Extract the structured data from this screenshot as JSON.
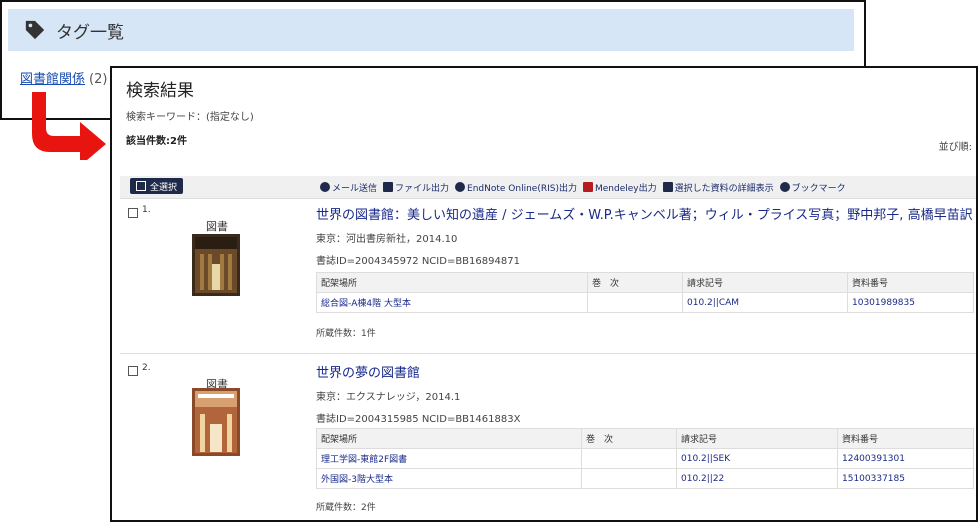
{
  "tag_panel": {
    "title": "タグ一覧",
    "tag_label": "図書館関係",
    "tag_count": "(2)"
  },
  "results": {
    "title": "検索結果",
    "keyword": "検索キーワード：(指定なし)",
    "count": "該当件数:2件",
    "sort": "並び順:",
    "toolbar": {
      "select_all": "全選択",
      "mail": "メール送信",
      "file": "ファイル出力",
      "endnote": "EndNote Online(RIS)出力",
      "mendeley": "Mendeley出力",
      "details": "選択した資料の詳細表示",
      "bookmark": "ブックマーク"
    },
    "columns": [
      "配架場所",
      "巻　次",
      "請求記号",
      "資料番号"
    ],
    "items": [
      {
        "num": "1.",
        "type": "図書",
        "title": "世界の図書館：美しい知の遺産 / ジェームズ・W.P.キャンベル著；ウィル・プライス写真；野中邦子, 高橋早苗訳",
        "pub": "東京：河出書房新社，2014.10",
        "ids": "書誌ID=2004345972 NCID=BB16894871",
        "holdings": [
          {
            "location": "総合図-A棟4階 大型本",
            "volume": "",
            "call": "010.2||CAM",
            "material": "10301989835"
          }
        ],
        "hcount": "所蔵件数：1件"
      },
      {
        "num": "2.",
        "type": "図書",
        "title": "世界の夢の図書館",
        "pub": "東京：エクスナレッジ，2014.1",
        "ids": "書誌ID=2004315985 NCID=BB1461883X",
        "holdings": [
          {
            "location": "理工学図-東館2F図書",
            "volume": "",
            "call": "010.2||SEK",
            "material": "12400391301"
          },
          {
            "location": "外国図-3階大型本",
            "volume": "",
            "call": "010.2||22",
            "material": "15100337185"
          }
        ],
        "hcount": "所蔵件数：2件"
      }
    ]
  },
  "colors": {
    "accent": "#1a2a8a",
    "header_bg": "#d6e6f7",
    "arrow": "#e8140f"
  }
}
